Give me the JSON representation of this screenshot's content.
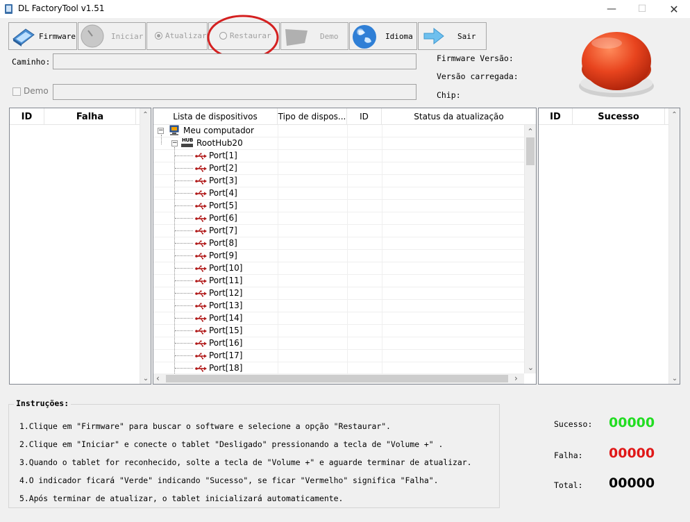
{
  "window": {
    "title": "DL FactoryTool v1.51",
    "minimize": "—",
    "maximize": "☐",
    "close": "✕"
  },
  "toolbar": {
    "firmware": "Firmware",
    "iniciar": "Iniciar",
    "atualizar": "Atualizar",
    "restaurar": "Restaurar",
    "demo": "Demo",
    "idioma": "Idioma",
    "sair": "Sair"
  },
  "form": {
    "caminho_label": "Caminho:",
    "caminho_value": "",
    "demo_label": "Demo",
    "demo_value": ""
  },
  "info": {
    "firmware_versao": "Firmware Versão:",
    "versao_carregada": "Versão carregada:",
    "chip": "Chip:"
  },
  "fail_panel": {
    "headers": [
      "ID",
      "Falha"
    ]
  },
  "success_panel": {
    "headers": [
      "ID",
      "Sucesso"
    ]
  },
  "device_list": {
    "headers": [
      "Lista de dispositivos",
      "Tipo de dispos...",
      "ID",
      "Status da atualização"
    ],
    "root": "Meu computador",
    "hub": "RootHub20",
    "hub_icon_text": "HUB",
    "ports": [
      "Port[1]",
      "Port[2]",
      "Port[3]",
      "Port[4]",
      "Port[5]",
      "Port[6]",
      "Port[7]",
      "Port[8]",
      "Port[9]",
      "Port[10]",
      "Port[11]",
      "Port[12]",
      "Port[13]",
      "Port[14]",
      "Port[15]",
      "Port[16]",
      "Port[17]",
      "Port[18]"
    ]
  },
  "instructions": {
    "title": "Instruções:",
    "lines": [
      "1.Clique em \"Firmware\" para buscar o software e selecione a opção \"Restaurar\".",
      "2.Clique em \"Iniciar\" e conecte o tablet \"Desligado\" pressionando a tecla de \"Volume +\" .",
      "3.Quando o tablet for reconhecido, solte a tecla de \"Volume +\" e aguarde terminar de atualizar.",
      "4.O indicador ficará \"Verde\" indicando \"Sucesso\", se ficar \"Vermelho\" significa \"Falha\".",
      "5.Após terminar de atualizar, o tablet inicializará automaticamente."
    ]
  },
  "stats": {
    "sucesso_label": "Sucesso:",
    "sucesso_value": "00000",
    "falha_label": "Falha:",
    "falha_value": "00000",
    "total_label": "Total:",
    "total_value": "00000"
  },
  "colors": {
    "success": "#22dd22",
    "fail": "#e01818",
    "total": "#000000",
    "annotation": "#d42020",
    "indicator": "#e8441e"
  }
}
